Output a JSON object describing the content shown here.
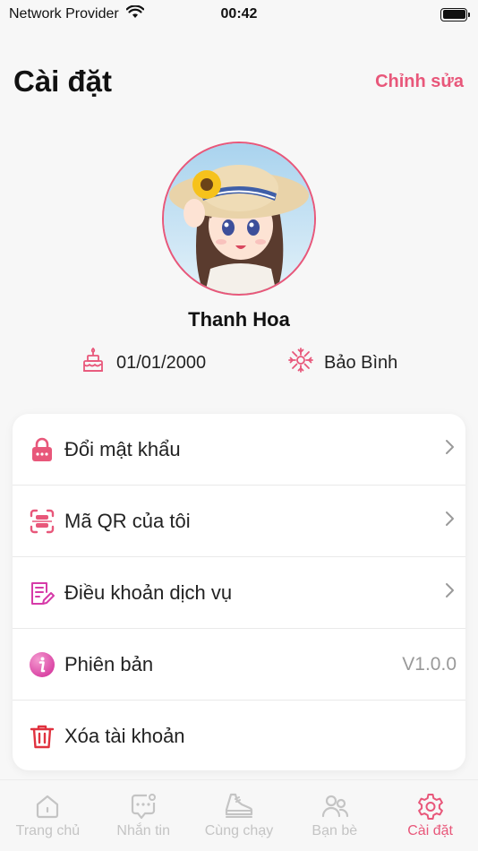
{
  "status_bar": {
    "carrier": "Network Provider",
    "time": "00:42",
    "battery_level": 1.0
  },
  "header": {
    "title": "Cài đặt",
    "edit_label": "Chỉnh sửa"
  },
  "profile": {
    "name": "Thanh Hoa",
    "birthday": "01/01/2000",
    "zodiac": "Bảo Bình"
  },
  "menu": {
    "items": [
      {
        "label": "Đổi mật khẩu",
        "icon": "lock-icon",
        "right": ""
      },
      {
        "label": "Mã QR của tôi",
        "icon": "qr-scan-icon",
        "right": ""
      },
      {
        "label": "Điều khoản dịch vụ",
        "icon": "document-edit-icon",
        "right": ""
      },
      {
        "label": "Phiên bản",
        "icon": "info-icon",
        "right": "V1.0.0"
      },
      {
        "label": "Xóa tài khoản",
        "icon": "trash-icon",
        "right": ""
      }
    ]
  },
  "tabs": [
    {
      "label": "Trang chủ",
      "icon": "home-icon",
      "active": false
    },
    {
      "label": "Nhắn tin",
      "icon": "chat-icon",
      "active": false
    },
    {
      "label": "Cùng chạy",
      "icon": "shoe-icon",
      "active": false
    },
    {
      "label": "Bạn bè",
      "icon": "friends-icon",
      "active": false
    },
    {
      "label": "Cài đặt",
      "icon": "gear-icon",
      "active": true
    }
  ],
  "colors": {
    "accent": "#e8577a",
    "background": "#f7f7f7",
    "inactive": "#c4c4c4",
    "danger": "#e0323f"
  }
}
